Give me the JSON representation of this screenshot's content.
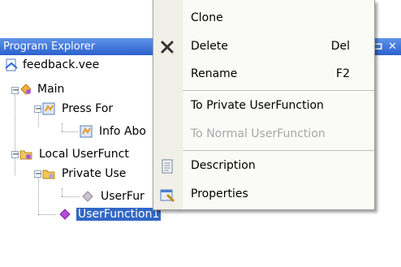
{
  "explorer": {
    "title": "Program Explorer",
    "controls": {
      "pin": "⊐",
      "close": "✕"
    },
    "tree": [
      {
        "label": "feedback.vee",
        "icon": "vee-file-icon"
      },
      {
        "label": "Main",
        "icon": "main-program-icon"
      },
      {
        "label": "Press For",
        "icon": "object-icon"
      },
      {
        "label": "Info Abo",
        "icon": "object-icon"
      },
      {
        "label": "Local UserFunct",
        "icon": "folder-icon"
      },
      {
        "label": "Private Use",
        "icon": "folder-icon"
      },
      {
        "label": "UserFur",
        "icon": "userfunction-icon"
      },
      {
        "label": "UserFunction1",
        "icon": "userfunction-icon",
        "selected": true
      }
    ]
  },
  "menu": {
    "items": [
      {
        "label": "Clone",
        "shortcut": ""
      },
      {
        "label": "Delete",
        "shortcut": "Del",
        "icon": "delete-icon"
      },
      {
        "label": "Rename",
        "shortcut": "F2"
      },
      {
        "label": "To Private UserFunction",
        "shortcut": ""
      },
      {
        "label": "To Normal UserFunction",
        "shortcut": "",
        "disabled": true
      },
      {
        "label": "Description",
        "shortcut": "",
        "icon": "description-icon"
      },
      {
        "label": "Properties",
        "shortcut": "",
        "icon": "properties-icon"
      }
    ]
  },
  "colors": {
    "titlebar": "#2b61cf",
    "selection": "#3168c6",
    "menu_bg": "#fafaf7"
  }
}
